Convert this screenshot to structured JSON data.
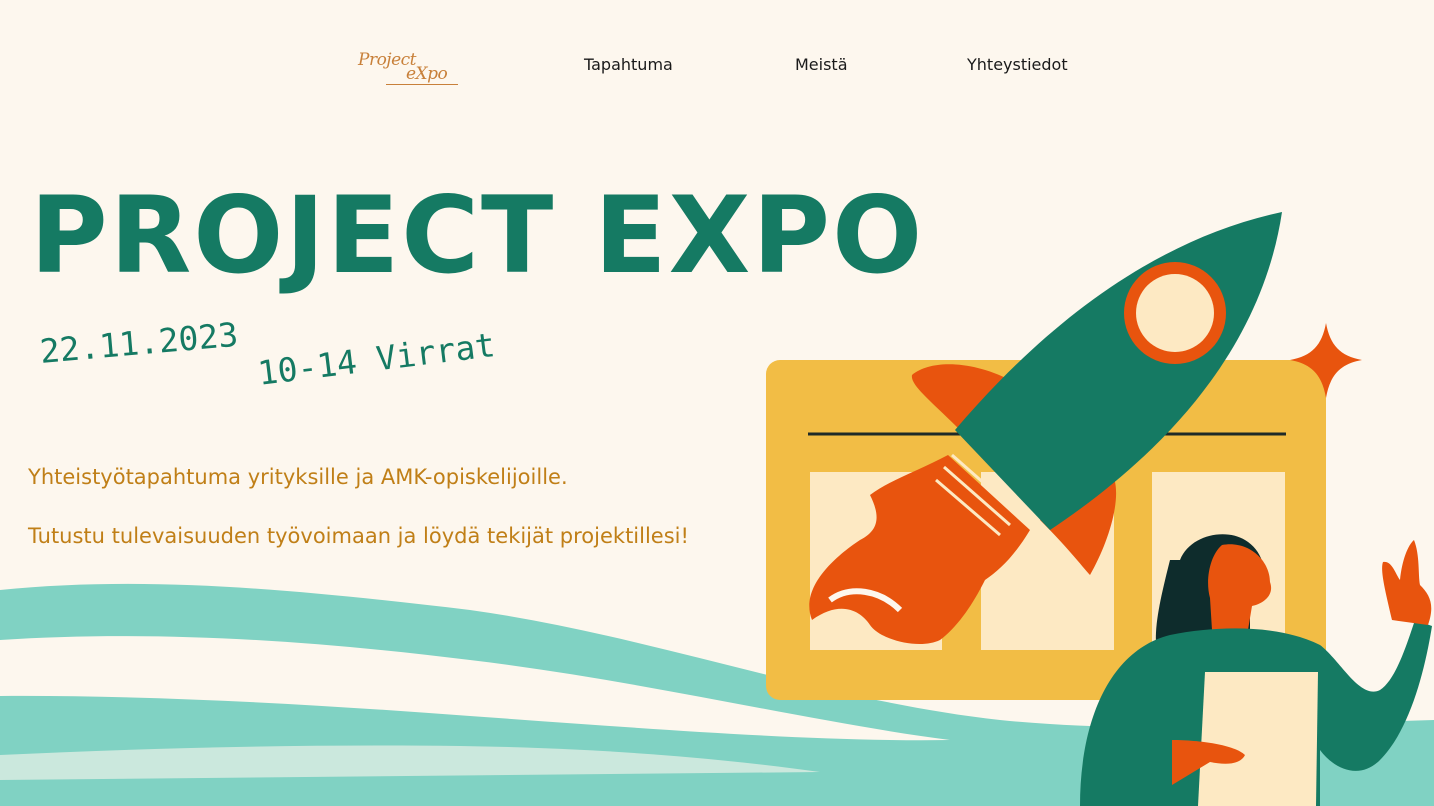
{
  "nav": {
    "logo_line1": "Project",
    "logo_line2": "eXpo",
    "links": [
      "Tapahtuma",
      "Meistä",
      "Yhteystiedot"
    ]
  },
  "hero": {
    "title": "PROJECT EXPO",
    "date": "22.11.2023",
    "time_place": "10-14 Virrat",
    "description_1": "Yhteistyötapahtuma yrityksille ja AMK-opiskelijoille.",
    "description_2": "Tutustu tulevaisuuden työvoimaan ja löydä tekijät projektillesi!"
  },
  "colors": {
    "background": "#fdf7ee",
    "primary_green": "#157a63",
    "accent_orange": "#e8540e",
    "accent_yellow": "#f2bd45",
    "text_gold": "#c07f17",
    "wave_teal": "#80d2c3"
  },
  "icons": [
    "rocket-illustration",
    "sparkle-star-icon",
    "presenter-woman-illustration",
    "wave-decoration"
  ]
}
